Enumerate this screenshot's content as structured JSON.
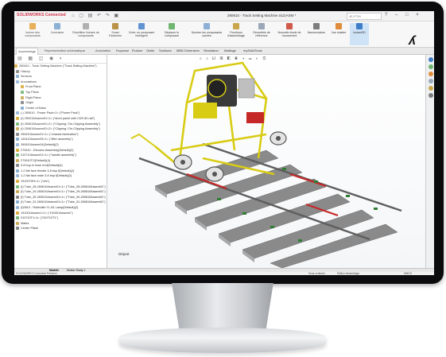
{
  "titlebar": {
    "app": "SOLIDWORKS Connected",
    "document": "280610 - Track Setting Machine.SLDASM *",
    "search_placeholder": "4E-PTM",
    "window_controls": "?  –  □  ×"
  },
  "ribbon": {
    "buttons": [
      {
        "label": "Insérer des composants"
      },
      {
        "label": "Contrainte"
      },
      {
        "label": "Répétition linéaire de composants"
      },
      {
        "label": "Smart Fasteners"
      },
      {
        "label": "Créer un composant intelligent"
      },
      {
        "label": "Déplacer le composant"
      },
      {
        "label": "Montrer les composants cachés"
      },
      {
        "label": "Fonctions d'assemblage"
      },
      {
        "label": "Géométrie de référence"
      },
      {
        "label": "Nouvelle étude de mouvement"
      },
      {
        "label": "Nomenclature"
      },
      {
        "label": "Vue éclatée"
      },
      {
        "label": "Instant3D"
      }
    ]
  },
  "tabs": [
    {
      "label": "Assemblage"
    },
    {
      "label": "Représentation schématique"
    },
    {
      "label": "Annotation"
    },
    {
      "label": "Esquisse"
    },
    {
      "label": "Évaluer"
    },
    {
      "label": "Outils"
    },
    {
      "label": "Surfaces"
    },
    {
      "label": "MBD Dimension"
    },
    {
      "label": "Simulation"
    },
    {
      "label": "Maillage"
    },
    {
      "label": "mySolidTools"
    }
  ],
  "tree": {
    "root": "280610 - Track Setting Machine (\"Track Setting Machine\")",
    "items": [
      "History",
      "Sensors",
      "Annotations",
      "Front Plane",
      "Top Plane",
      "Right Plane",
      "Origin",
      "Center of Mass",
      "(-) 280610 - Power Pack<1> (\"Power Pack\")",
      "(f) 250010Assem01<1> (\"short panel with CDS 60 rail\")",
      "(f) 250610Assem01<2> (\"Clipping / De-Clipping Assembly\")",
      "(f) 250610Assem01<2> (\"Clipping / De-Clipping Assembly\")",
      "250610Assem01<1> (\"chassis fabrication\")",
      "140410Assem05<1> (\"lifter assembly\")",
      "260610Assem04(Default)(2)",
      "270610 - Elevator Assembly(Default)(2)",
      "010710Assem01<1> (\"handle assembly\")",
      "270610TO(Default)(4)",
      "3-8 buy-in hose end(Default)(4)",
      "1-2 flat face female 3-8 bsp f(Default)(2)",
      "1-2 flat face male 3-8 bsp f(Default)(2)",
      "191007HH<1> (\"cfa\")",
      "(f) Tube_28-260610Assem01<1> (\"Tube_28-260610Assem01\")",
      "(f) Tube_29-260610Assem01<1> (\"Tube_29-260610Assem01\")",
      "(f) Tube_30-260610Assem01<1> (\"Tube_30-260610Assem01\")",
      "(f) Tube_31-260610Assem01<1> (\"Tube_31-260610Assem01\")",
      "(f)0610 - Rubbolite YL-81 Lamp(Default)(2)",
      "191001Assem1<1> (\"191001Assem1\")",
      "010710T1<1> (\"010710T1\")",
      "Mates",
      "Center Plane"
    ]
  },
  "graphics": {
    "label_depart": "Départ"
  },
  "bottom": {
    "model_tab": "Modèle",
    "motion_tab": "Motion Study 1",
    "status_left": "SOLIDWORKS Connected Premium",
    "status_mid": "Sous-contraint",
    "status_edit": "Édition Assemblage",
    "status_units": "MMGS"
  },
  "colors": {
    "machine_yellow": "#d8cc14",
    "rail_red": "#c62828",
    "sleeper_gray": "#8a8a8a",
    "brand_red": "#c8102e",
    "active_ribbon": "#cfe3f6"
  }
}
